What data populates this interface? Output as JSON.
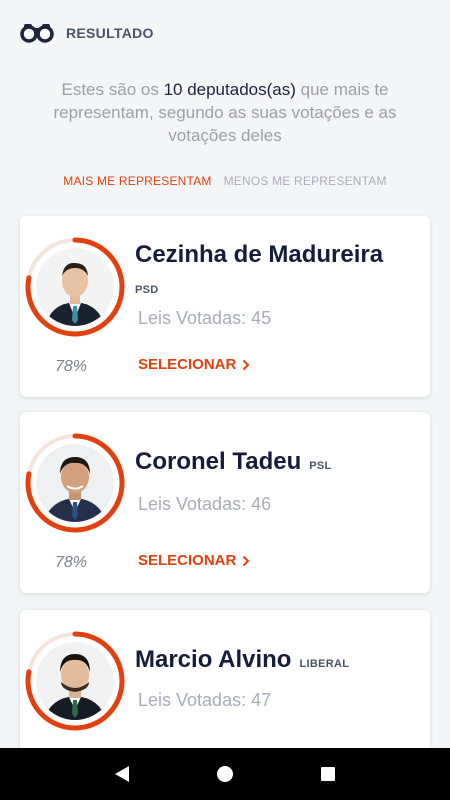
{
  "header": {
    "title": "RESULTADO",
    "logo_icon": "binoculars-icon"
  },
  "intro": {
    "prefix": "Estes são os ",
    "highlight": "10 deputados(as)",
    "suffix": " que mais te representam, segundo as suas votações e as votações deles"
  },
  "tabs": [
    {
      "label": "MAIS ME REPRESENTAM",
      "active": true
    },
    {
      "label": "MENOS ME REPRESENTAM",
      "active": false
    }
  ],
  "accent_color": "#e2410f",
  "deputies": [
    {
      "name": "Cezinha de Madureira",
      "party": "PSD",
      "votes_label": "Leis Votadas: 45",
      "percent": "78%",
      "match": 0.78,
      "select_label": "SELECIONAR"
    },
    {
      "name": "Coronel Tadeu",
      "party": "PSL",
      "votes_label": "Leis Votadas: 46",
      "percent": "78%",
      "match": 0.78,
      "select_label": "SELECIONAR"
    },
    {
      "name": "Marcio Alvino",
      "party": "LIBERAL",
      "votes_label": "Leis Votadas: 47",
      "percent": "",
      "match": 0.78,
      "select_label": ""
    }
  ],
  "navbar": {
    "back_icon": "back-icon",
    "home_icon": "home-icon",
    "recents_icon": "recents-icon"
  }
}
